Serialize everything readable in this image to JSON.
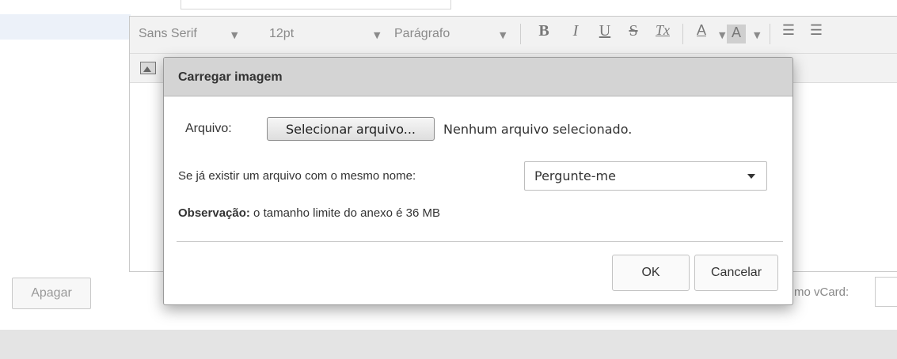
{
  "toolbar": {
    "font_family": "Sans Serif",
    "font_size": "12pt",
    "block_format": "Parágrafo",
    "bold": "B",
    "italic": "I",
    "underline": "U",
    "strike": "S",
    "clear_format": "Tx",
    "font_color": "A",
    "highlight": "A"
  },
  "background": {
    "delete_label": "Apagar",
    "vcard_label": "mo vCard:"
  },
  "dialog": {
    "title": "Carregar imagem",
    "file_label": "Arquivo:",
    "file_button": "Selecionar arquivo...",
    "file_status": "Nenhum arquivo selecionado.",
    "exists_label": "Se já existir um arquivo com o mesmo nome:",
    "exists_value": "Pergunte-me",
    "note_bold": "Observação:",
    "note_text": " o tamanho limite do anexo é 36 MB",
    "ok": "OK",
    "cancel": "Cancelar"
  }
}
